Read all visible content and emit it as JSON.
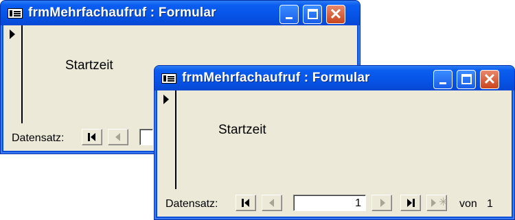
{
  "windows": [
    {
      "title": "frmMehrfachaufruf : Formular",
      "field_label": "Startzeit",
      "nav": {
        "label": "Datensatz:"
      }
    },
    {
      "title": "frmMehrfachaufruf : Formular",
      "field_label": "Startzeit",
      "nav": {
        "label": "Datensatz:",
        "record_value": "1",
        "of_label": "von",
        "total": "1"
      }
    }
  ],
  "icons": {
    "window": "form-icon",
    "first": "first-record-icon",
    "prev": "previous-record-icon",
    "next": "next-record-icon",
    "last": "last-record-icon",
    "new": "new-record-icon",
    "minimize": "minimize-icon",
    "maximize": "maximize-icon",
    "close": "close-icon"
  },
  "colors": {
    "titlebar": "#0655e8",
    "client": "#ece9d8",
    "close_button": "#c8461e"
  }
}
